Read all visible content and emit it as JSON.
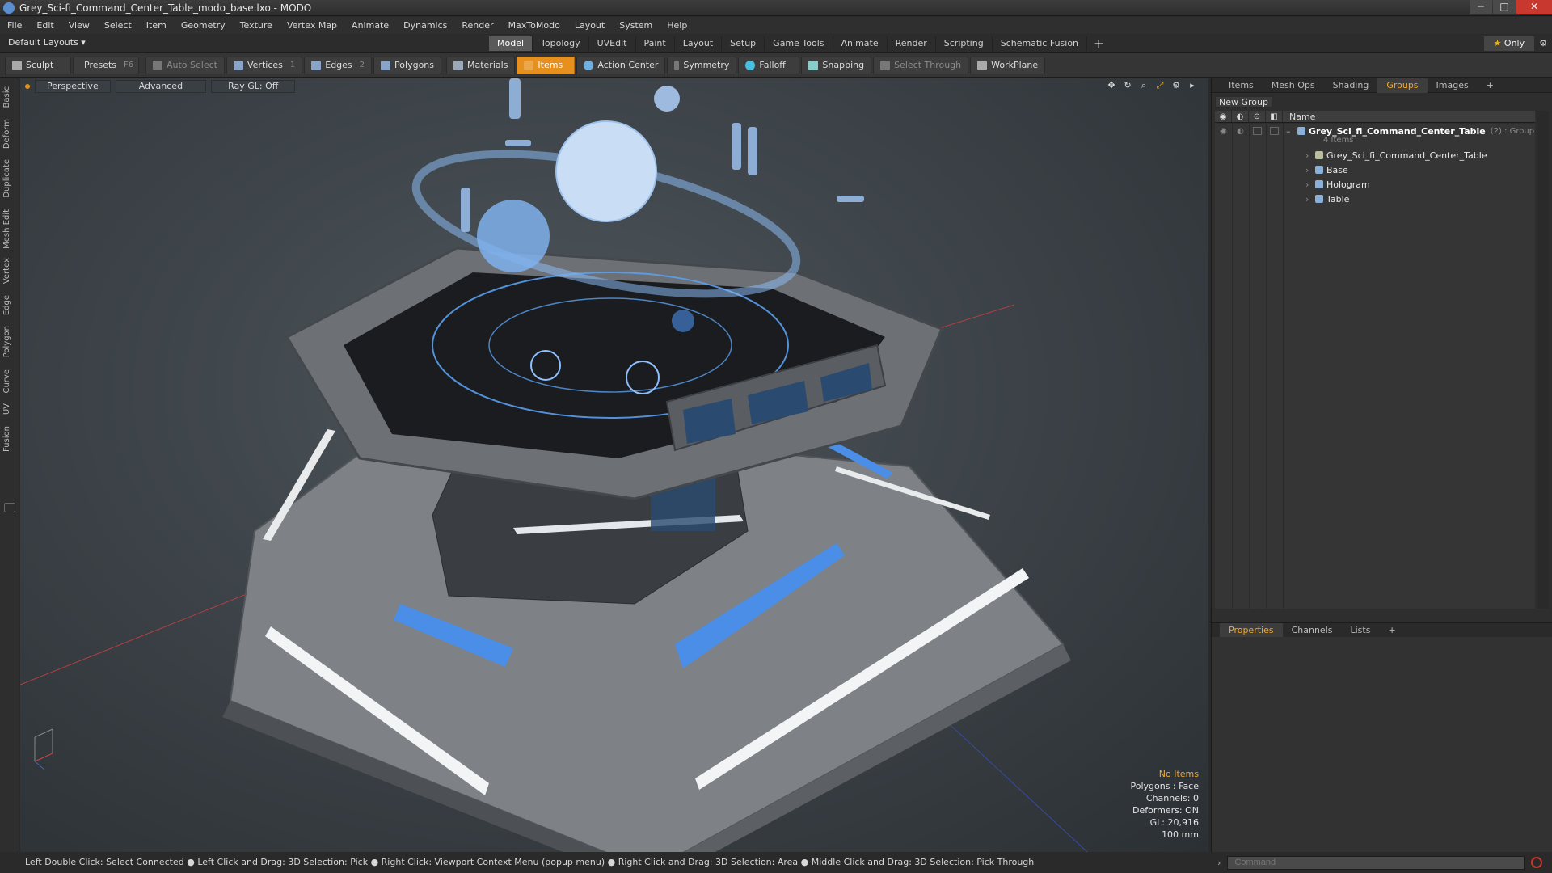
{
  "window": {
    "title": "Grey_Sci-fi_Command_Center_Table_modo_base.lxo - MODO",
    "minimize": "─",
    "maximize": "□",
    "close": "✕"
  },
  "menu": [
    "File",
    "Edit",
    "View",
    "Select",
    "Item",
    "Geometry",
    "Texture",
    "Vertex Map",
    "Animate",
    "Dynamics",
    "Render",
    "MaxToModo",
    "Layout",
    "System",
    "Help"
  ],
  "layouts": {
    "label": "Default Layouts ▾",
    "tabs": [
      "Model",
      "Topology",
      "UVEdit",
      "Paint",
      "Layout",
      "Setup",
      "Game Tools",
      "Animate",
      "Render",
      "Scripting",
      "Schematic Fusion"
    ],
    "active": "Model",
    "add": "+",
    "only": "Only"
  },
  "toolbar": {
    "sculpt": "Sculpt",
    "presets": "Presets",
    "presets_key": "F6",
    "auto_select": "Auto Select",
    "vertices": "Vertices",
    "vertices_num": "1",
    "edges": "Edges",
    "edges_num": "2",
    "polygons": "Polygons",
    "materials": "Materials",
    "items": "Items",
    "action_center": "Action Center",
    "symmetry": "Symmetry",
    "falloff": "Falloff",
    "snapping": "Snapping",
    "select_through": "Select Through",
    "workplane": "WorkPlane"
  },
  "left_tabs": [
    "Basic",
    "Deform",
    "Duplicate",
    "Mesh Edit",
    "Vertex",
    "Edge",
    "Polygon",
    "Curve",
    "UV",
    "Fusion"
  ],
  "viewport": {
    "perspective": "Perspective",
    "advanced": "Advanced",
    "raygl": "Ray GL: Off",
    "stats": {
      "no_items": "No Items",
      "polygons": "Polygons : Face",
      "channels": "Channels: 0",
      "deformers": "Deformers: ON",
      "gl": "GL: 20,916",
      "scale": "100 mm"
    }
  },
  "right_panel": {
    "tabs": [
      "Items",
      "Mesh Ops",
      "Shading",
      "Groups",
      "Images"
    ],
    "active_tab": "Groups",
    "add": "+",
    "new_group": "New Group",
    "name_header": "Name",
    "group": {
      "name": "Grey_Sci_fi_Command_Center_Table",
      "count": "(2) : Group",
      "items_count": "4 Items"
    },
    "children": [
      "Grey_Sci_fi_Command_Center_Table",
      "Base",
      "Hologram",
      "Table"
    ]
  },
  "props": {
    "tabs": [
      "Properties",
      "Channels",
      "Lists"
    ],
    "active": "Properties",
    "add": "+"
  },
  "status": "Left Double Click: Select Connected ● Left Click and Drag: 3D Selection: Pick ● Right Click: Viewport Context Menu (popup menu) ● Right Click and Drag: 3D Selection: Area ● Middle Click and Drag: 3D Selection: Pick Through",
  "command": {
    "placeholder": "Command"
  },
  "colors": {
    "accent": "#e8901e",
    "active_text": "#f0a830",
    "hologram": "#8ab8f0"
  }
}
